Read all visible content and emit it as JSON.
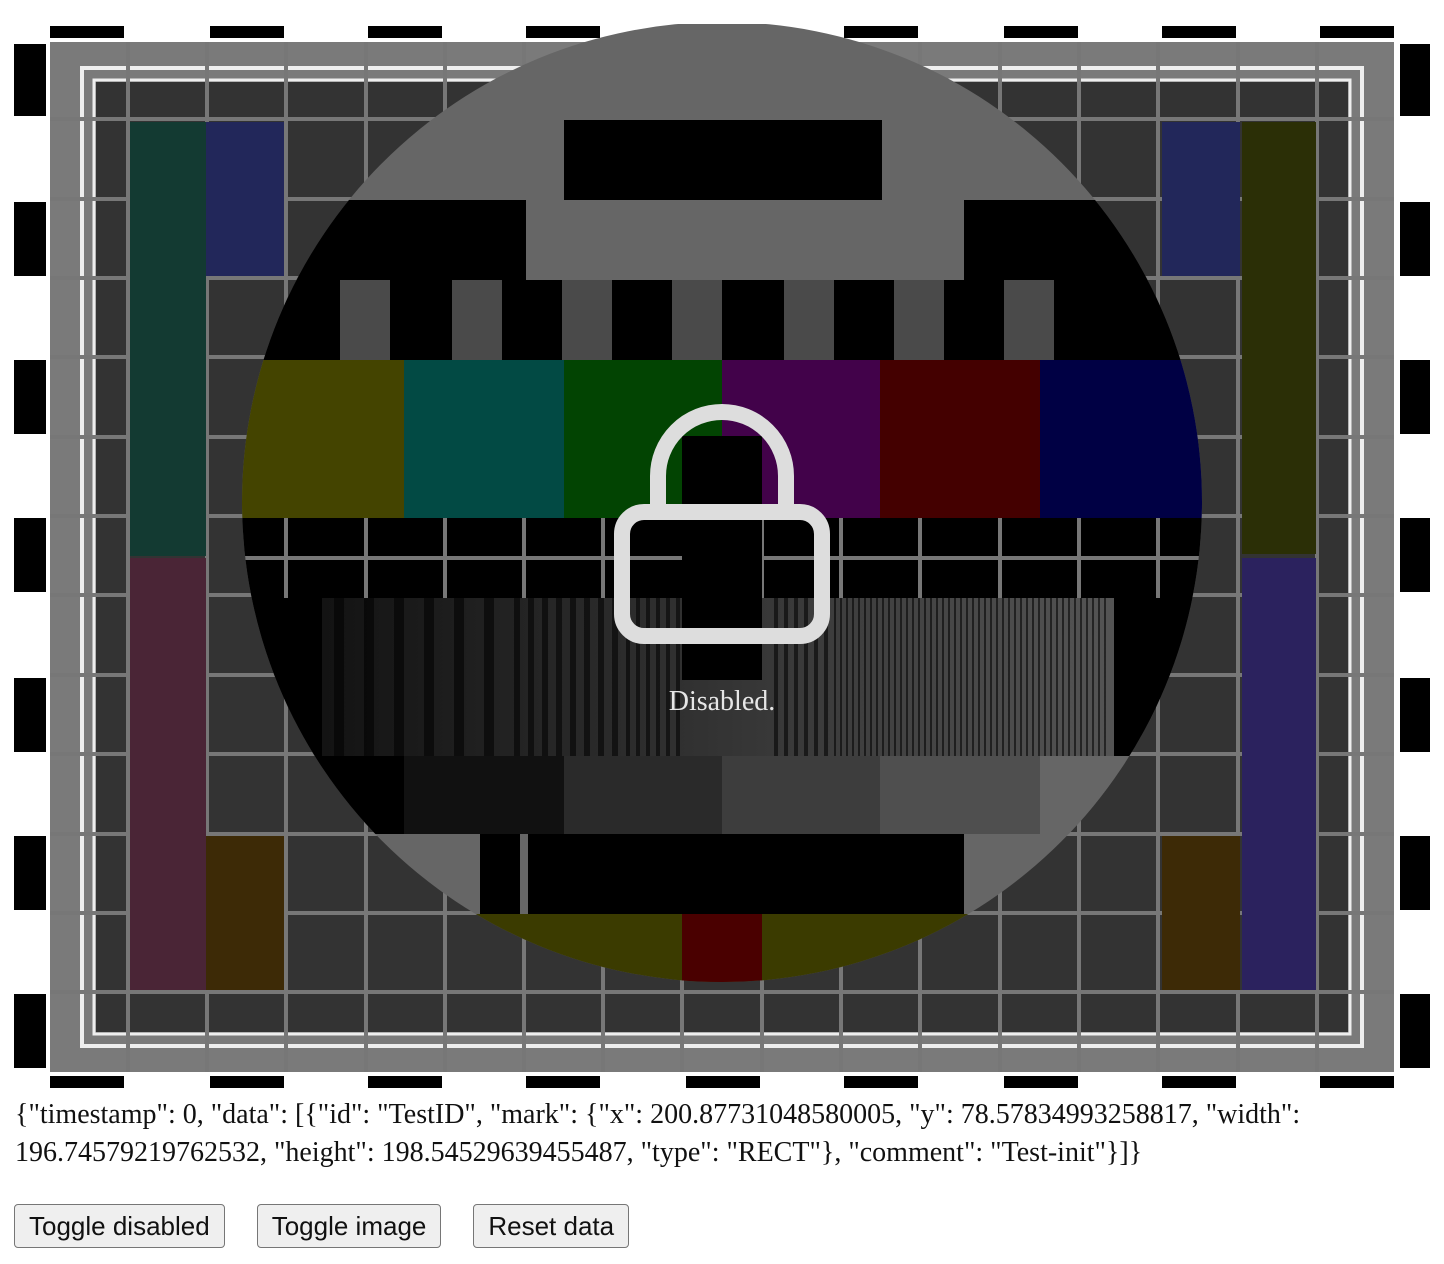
{
  "viewer": {
    "status_text": "Disabled.",
    "lock_icon": "lock-icon",
    "background": "tv-test-card"
  },
  "debug": {
    "json_text": "{\"timestamp\": 0, \"data\": [{\"id\": \"TestID\", \"mark\": {\"x\": 200.87731048580005, \"y\": 78.57834993258817, \"width\": 196.74579219762532, \"height\": 198.54529639455487, \"type\": \"RECT\"}, \"comment\": \"Test-init\"}]}"
  },
  "controls": {
    "toggle_disabled": "Toggle disabled",
    "toggle_image": "Toggle image",
    "reset_data": "Reset data"
  },
  "colors": {
    "grid_bg": "#333333",
    "grid_line": "#777777",
    "lock": "#dddddd"
  }
}
